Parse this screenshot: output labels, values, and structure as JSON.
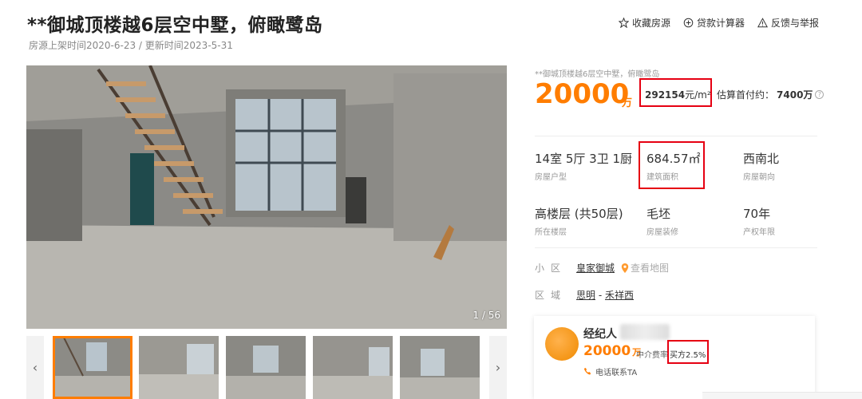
{
  "listing": {
    "title": "**御城顶楼越6层空中墅，俯瞰鹭岛",
    "subinfo": "房源上架时间2020-6-23 / 更新时间2023-5-31",
    "small_title": "**御城顶楼越6层空中墅，俯瞰鹭岛"
  },
  "actions": {
    "favorite": "收藏房源",
    "calculator": "贷款计算器",
    "report": "反馈与举报"
  },
  "gallery": {
    "counter": "1 / 56",
    "prev": "‹",
    "next": "›"
  },
  "price": {
    "total": "20000",
    "total_unit": "万",
    "unit_price": "292154",
    "unit_price_suffix": "元/m²",
    "downpay_label": "估算首付约：",
    "downpay_value": "7400万",
    "help": "?"
  },
  "attributes": [
    {
      "value": "14室 5厅 3卫 1厨",
      "label": "房屋户型"
    },
    {
      "value": "684.57㎡",
      "label": "建筑面积"
    },
    {
      "value": "西南北",
      "label": "房屋朝向"
    },
    {
      "value": "高楼层 (共50层)",
      "label": "所在楼层"
    },
    {
      "value": "毛坯",
      "label": "房屋装修"
    },
    {
      "value": "70年",
      "label": "产权年限"
    }
  ],
  "community": {
    "label": "小区",
    "name": "皇家御城",
    "map_link": "查看地图"
  },
  "district": {
    "label": "区域",
    "area1": "思明",
    "sep": " - ",
    "area2": "禾祥西"
  },
  "agent": {
    "role": "经纪人",
    "price": "20000",
    "price_unit": "万",
    "fee_label": "中介费率",
    "fee_value": "买方2.5%",
    "call": "电话联系TA"
  },
  "colors": {
    "accent": "#ff7d00",
    "highlight_box": "#e60012"
  }
}
